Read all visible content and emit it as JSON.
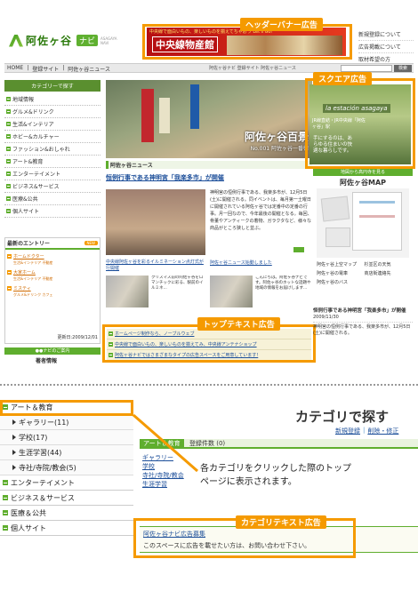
{
  "header": {
    "logo_text": "阿佐ヶ谷",
    "logo_badge": "ナビ",
    "logo_sub": "ASAGAYA NAVI",
    "banner_text": "中央線物産館",
    "banner_caption": "中央線で面白いもの、楽しいものを揃えてちゃおう  Let's Go!",
    "links": [
      "新規登録について",
      "広告掲載について",
      "取材希望の方"
    ]
  },
  "nav": {
    "items": [
      "HOME",
      "登録サイト",
      "阿佐ヶ谷ニュース"
    ],
    "breadcrumb": "阿佐ヶ谷ナビ  登録サイト  阿佐ヶ谷ニュース",
    "search_button": "検索"
  },
  "sidebar": {
    "heading": "カテゴリーで探す",
    "categories": [
      "地域情報",
      "グルメ&ドリンク",
      "生活&インテリア",
      "ホビー&カルチャー",
      "ファッション&おしゃれ",
      "アート&教育",
      "エンターテイメント",
      "ビジネス&サービス",
      "医療&公共",
      "個人サイト"
    ],
    "recent_title": "最新のエントリー",
    "new_badge": "NEW",
    "entries": [
      {
        "title": "ホームドクター",
        "sub": "生活&インテリア 不動産"
      },
      {
        "title": "大家ホーム",
        "sub": "生活&インテリア 不動産"
      },
      {
        "title": "ミスティ",
        "sub": "グルメ&ドリンク カフェ"
      }
    ],
    "updated": "更新日:2009/12/01",
    "footer_label": "●●ナビのご案内",
    "footer_sub": "著者情報"
  },
  "hero": {
    "title": "阿佐ヶ谷百景",
    "subtitle": "No.001 阿佐ヶ谷一番街"
  },
  "news": {
    "section": "阿佐ヶ谷ニュース",
    "headline": "恒例行事である神明宮「我楽多市」が開催",
    "body": "神明宮の恒例行事である、我楽多市が、12月5日(土)に開催される。同イベントは、毎月第一土曜日に開催されている阿佐ヶ谷では定番中の定番の行事。月一回なので、今年最後の開催となる。毎回、骨董やアンティークの着物、ガラクタなど、様々な商品がところ狭しと並ぶ。",
    "links": [
      "中央線阿佐ヶ谷を彩るイルミネーション点灯式が行開催",
      "阿佐ヶ谷ニュース始動しました"
    ],
    "thumb1_text": "クリスマス前の阿佐ヶ谷をロマンチックに彩る、駅前のイルミネ...",
    "thumb2_text": "こんにちは。阿佐ヶ谷ナビです。阿佐ヶ谷のホットな話題や地域の情報をお届けします..."
  },
  "text_ads": [
    "ホームページ制作なら、ノーブルウェブ",
    "中央線で面白いもの、楽しいものを揃えてみ、中央線アンテナショップ",
    "阿佐ヶ谷ナビではさまざまなタイプの広告スペースをご用意しています!"
  ],
  "right": {
    "square_logo": "la estación asagaya",
    "square_text": "JR線直結・JR中央線「阿佐ヶ谷」駅",
    "square_tagline": "手にするのは、あらゆる住まいの快適な暮らしです。",
    "map_label": "地図から高円寺を見る",
    "map_title": "阿佐ヶ谷MAP",
    "map_links": [
      "阿佐ヶ谷上空マップ",
      "杉並区の天気",
      "阿佐ヶ谷の電車",
      "商店街連絡先",
      "阿佐ヶ谷のバス",
      ""
    ],
    "news_items": [
      {
        "title": "恒例行事である神明宮「我楽多市」が開催",
        "date": "2009/11/30"
      },
      {
        "title": "神明宮の恒例行事である、我楽多市が、12月5日(土)に開催される。",
        "date": ""
      }
    ]
  },
  "callouts": {
    "header_banner": "ヘッダーバナー広告",
    "square": "スクエア広告",
    "top_text": "トップテキスト広告",
    "category_text": "カテゴリテキスト広告"
  },
  "bottom": {
    "categories": [
      {
        "label": "アート＆教育",
        "sub": false
      },
      {
        "label": "ギャラリー(11)",
        "sub": true
      },
      {
        "label": "学校(17)",
        "sub": true
      },
      {
        "label": "生涯学習(44)",
        "sub": true
      },
      {
        "label": "寺社/寺院/教会(5)",
        "sub": true
      },
      {
        "label": "エンターテイメント",
        "sub": false
      },
      {
        "label": "ビジネス＆サービス",
        "sub": false
      },
      {
        "label": "医療＆公共",
        "sub": false
      },
      {
        "label": "個人サイト",
        "sub": false
      }
    ],
    "page_title": "カテゴリで探す",
    "action_links": [
      "新規登録",
      "削除・修正"
    ],
    "tab_label": "アート＆教育",
    "tab_count": "登録件数 (0)",
    "sub_links": [
      "ギャラリー",
      "学校",
      "寺社/寺院/教会",
      "生涯学習"
    ],
    "explanation": "各カテゴリをクリックした際のトップページに表示されます。",
    "cat_ad_title": "阿佐ヶ谷ナビ広告募集",
    "cat_ad_body": "このスペースに広告を載せたい方は、お問い合わせ下さい。"
  },
  "colors": {
    "accent": "#f59a00",
    "green": "#5fae2e",
    "link": "#1d4f9a"
  }
}
